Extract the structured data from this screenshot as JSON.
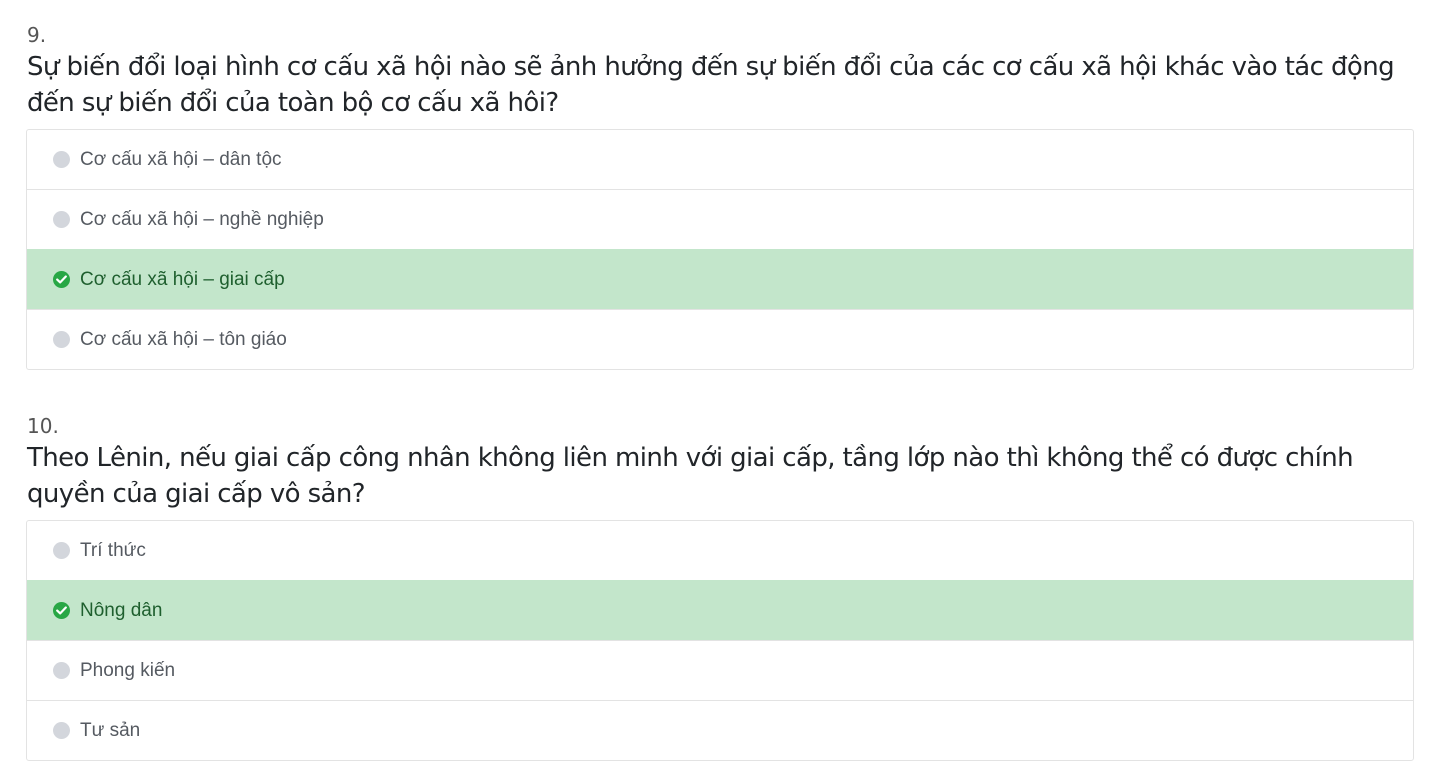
{
  "questions": [
    {
      "number": "9.",
      "text": "Sự biến đổi loại hình cơ cấu xã hội nào sẽ ảnh hưởng đến sự biến đổi của các cơ cấu xã hội khác vào tác động đến sự biến đổi của toàn bộ cơ cấu xã hôi?",
      "options": [
        {
          "label": "Cơ cấu xã hội – dân tộc",
          "correct": false
        },
        {
          "label": "Cơ cấu xã hội – nghề nghiệp",
          "correct": false
        },
        {
          "label": "Cơ cấu xã hội – giai cấp",
          "correct": true
        },
        {
          "label": "Cơ cấu xã hội – tôn giáo",
          "correct": false
        }
      ]
    },
    {
      "number": "10.",
      "text": "Theo Lênin, nếu giai cấp công nhân không liên minh với giai cấp, tầng lớp nào thì không thể có được chính quyền của giai cấp vô sản?",
      "options": [
        {
          "label": "Trí thức",
          "correct": false
        },
        {
          "label": "Nông dân",
          "correct": true
        },
        {
          "label": "Phong kiến",
          "correct": false
        },
        {
          "label": "Tư sản",
          "correct": false
        }
      ]
    }
  ],
  "colors": {
    "correct_bg": "#c3e6cb",
    "correct_icon": "#28a745",
    "radio": "#d3d6dc",
    "border": "#e3e3e3"
  },
  "icons": {
    "correct": "check-circle-icon",
    "unselected": "radio-circle-icon"
  }
}
